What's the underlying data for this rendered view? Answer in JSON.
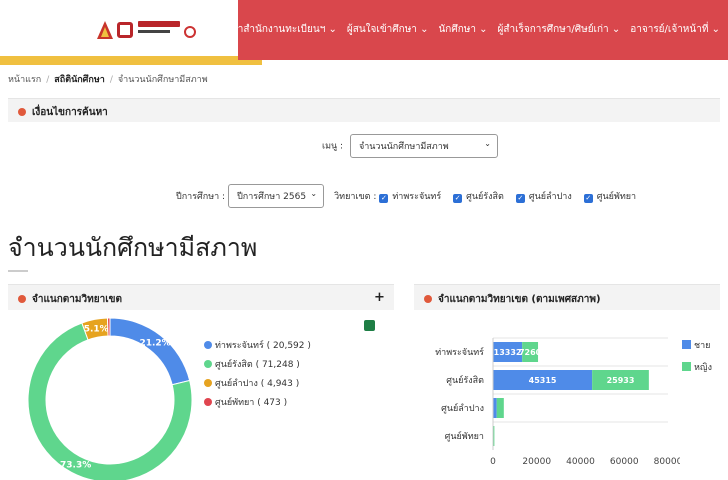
{
  "header": {
    "nav": [
      "แนะนำสำนักงานทะเบียนฯ ⌄",
      "ผู้สนใจเข้าศึกษา ⌄",
      "นักศึกษา ⌄",
      "ผู้สำเร็จการศึกษา/ศิษย์เก่า ⌄",
      "อาจารย์/เจ้าหน้าที่ ⌄"
    ]
  },
  "breadcrumb": {
    "home": "หน้าแรก",
    "stats": "สถิตินักศึกษา",
    "current": "จำนวนนักศึกษามีสภาพ"
  },
  "search": {
    "title": "เงื่อนไขการค้นหา",
    "menu_label": "เมนู :",
    "menu_value": "จำนวนนักศึกษามีสภาพ",
    "year_label": "ปีการศึกษา :",
    "year_value": "ปีการศึกษา 2565",
    "campus_label": "วิทยาเขต :",
    "campuses": [
      "ท่าพระจันทร์",
      "ศูนย์รังสิต",
      "ศูนย์ลำปาง",
      "ศูนย์พัทยา"
    ]
  },
  "page_title": "จำนวนนักศึกษามีสภาพ",
  "left_panel": {
    "title": "จำแนกตามวิทยาเขต",
    "plus": "+",
    "legend": [
      {
        "label": "ท่าพระจันทร์ ( 20,592 )",
        "color": "#4f8be8"
      },
      {
        "label": "ศูนย์รังสิต ( 71,248 )",
        "color": "#5fd68d"
      },
      {
        "label": "ศูนย์ลำปาง ( 4,943 )",
        "color": "#e6a320"
      },
      {
        "label": "ศูนย์พัทยา ( 473 )",
        "color": "#e0454f"
      }
    ]
  },
  "right_panel": {
    "title": "จำแนกตามวิทยาเขต (ตามเพศสภาพ)",
    "legend": [
      {
        "label": "ชาย",
        "color": "#4f8be8"
      },
      {
        "label": "หญิง",
        "color": "#5fd68d"
      }
    ]
  },
  "chart_data": [
    {
      "type": "pie",
      "title": "จำแนกตามวิทยาเขต",
      "categories": [
        "ท่าพระจันทร์",
        "ศูนย์รังสิต",
        "ศูนย์ลำปาง",
        "ศูนย์พัทยา"
      ],
      "values": [
        20592,
        71248,
        4943,
        473
      ],
      "labels": [
        "21.2%",
        "73.3%",
        "5.1%",
        ""
      ],
      "colors": [
        "#4f8be8",
        "#5fd68d",
        "#e6a320",
        "#e0454f"
      ],
      "legend": "right"
    },
    {
      "type": "bar",
      "orientation": "horizontal",
      "stacked": true,
      "title": "จำแนกตามวิทยาเขต (ตามเพศสภาพ)",
      "categories": [
        "ท่าพระจันทร์",
        "ศูนย์รังสิต",
        "ศูนย์ลำปาง",
        "ศูนย์พัทยา"
      ],
      "series": [
        {
          "name": "ชาย",
          "color": "#4f8be8",
          "values": [
            13332,
            45315,
            1700,
            170
          ],
          "labels": [
            "13332",
            "45315",
            "",
            ""
          ]
        },
        {
          "name": "หญิง",
          "color": "#5fd68d",
          "values": [
            7260,
            25933,
            3243,
            303
          ],
          "labels": [
            "7260",
            "25933",
            "",
            ""
          ]
        }
      ],
      "xlim": [
        0,
        80000
      ],
      "xticks": [
        "0",
        "20000",
        "40000",
        "60000",
        "80000"
      ],
      "legend": "right"
    }
  ]
}
